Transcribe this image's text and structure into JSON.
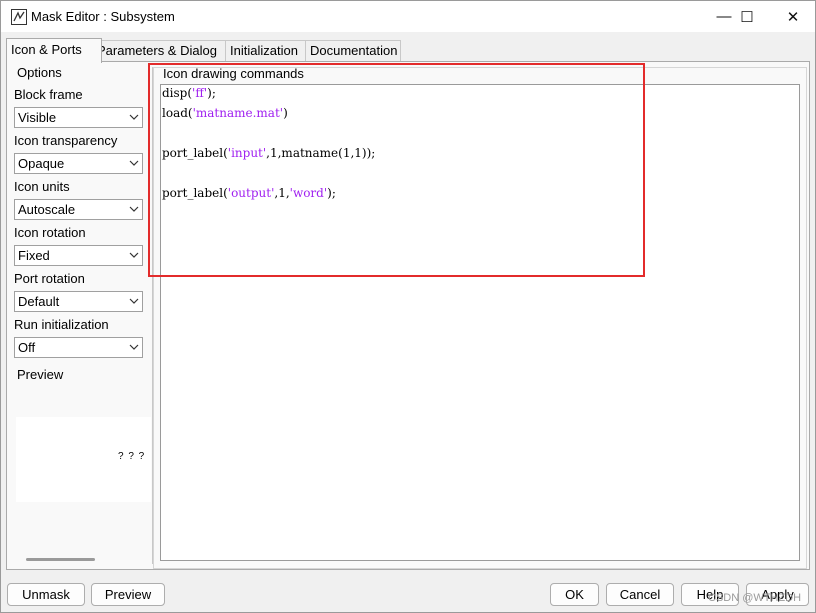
{
  "window": {
    "title": "Mask Editor : Subsystem",
    "controls": {
      "minimize": "—",
      "maximize": "☐",
      "close": "✕"
    }
  },
  "tabs": [
    {
      "label": "Icon & Ports"
    },
    {
      "label": "Parameters & Dialog"
    },
    {
      "label": "Initialization"
    },
    {
      "label": "Documentation"
    }
  ],
  "options": {
    "title": "Options",
    "fields": [
      {
        "label": "Block frame",
        "value": "Visible"
      },
      {
        "label": "Icon transparency",
        "value": "Opaque"
      },
      {
        "label": "Icon units",
        "value": "Autoscale"
      },
      {
        "label": "Icon rotation",
        "value": "Fixed"
      },
      {
        "label": "Port rotation",
        "value": "Default"
      },
      {
        "label": "Run initialization",
        "value": "Off"
      }
    ]
  },
  "preview": {
    "title": "Preview",
    "placeholder": "? ? ?"
  },
  "commands": {
    "title": "Icon drawing commands",
    "lines": [
      {
        "pre": "disp(",
        "str": "'ff'",
        "post": ");"
      },
      {
        "pre": "load(",
        "str": "'matname.mat'",
        "post": ")"
      },
      {
        "pre": "port_label(",
        "str": "'input'",
        "post": ",1,matname(1,1));"
      },
      {
        "pre": "port_label(",
        "str": "'output'",
        "mid": ",1,",
        "str2": "'word'",
        "post": ");"
      }
    ]
  },
  "buttons": {
    "unmask": "Unmask",
    "preview": "Preview",
    "ok": "OK",
    "cancel": "Cancel",
    "help": "Help",
    "apply": "Apply"
  },
  "watermark": "CSDN @WTHZDH",
  "colors": {
    "string_literal": "#a020f0",
    "highlight": "#e32b2b"
  }
}
